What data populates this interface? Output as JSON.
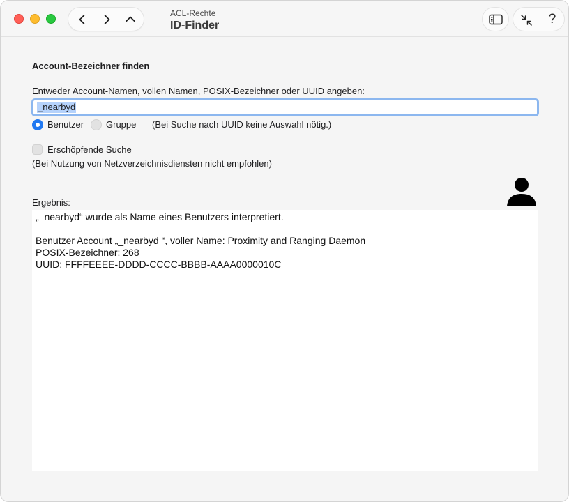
{
  "window": {
    "subtitle": "ACL-Rechte",
    "title": "ID-Finder",
    "help_label": "?"
  },
  "icons": {
    "close": "close-icon",
    "minimize": "minimize-icon",
    "zoom": "zoom-icon",
    "back": "chevron-left-icon",
    "forward": "chevron-right-icon",
    "up": "chevron-up-icon",
    "sidebar": "sidebar-icon",
    "collapse": "collapse-icon",
    "avatar": "user-icon"
  },
  "colors": {
    "accent": "#1f78f1",
    "selection": "#b5d2fb",
    "focus_ring": "#8cb7ef",
    "close": "#ff5f57",
    "minimize": "#febc2e",
    "zoom": "#28c840"
  },
  "form": {
    "section_title": "Account-Bezeichner finden",
    "prompt": "Entweder Account-Namen, vollen Namen, POSIX-Bezeichner oder UUID angeben:",
    "search_value": "_nearbyd",
    "radio_user": "Benutzer",
    "radio_group": "Gruppe",
    "radio_selected": "Benutzer",
    "radio_hint": "(Bei Suche nach UUID keine Auswahl nötig.)",
    "exhaustive_label": "Erschöpfende Suche",
    "exhaustive_checked": false,
    "exhaustive_note": "(Bei Nutzung von Netzverzeichnisdiensten nicht empfohlen)"
  },
  "result": {
    "label": "Ergebnis:",
    "lines": [
      "„_nearbyd“ wurde als Name eines Benutzers interpretiert.",
      "",
      "Benutzer Account „_nearbyd “, voller Name: Proximity and Ranging Daemon",
      "POSIX-Bezeichner: 268",
      "UUID: FFFFEEEE-DDDD-CCCC-BBBB-AAAA0000010C"
    ]
  }
}
